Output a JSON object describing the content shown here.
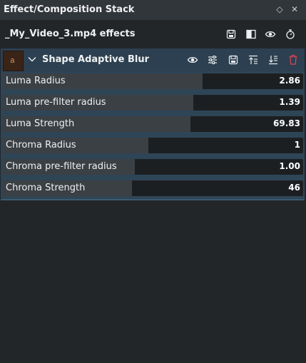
{
  "panel": {
    "title": "Effect/Composition Stack",
    "float_icon": "diamond-float-icon",
    "close_icon": "close-icon"
  },
  "clip": {
    "title": "_My_Video_3.mp4 effects",
    "actions": [
      {
        "name": "save-stack-button",
        "icon": "save-icon"
      },
      {
        "name": "split-compare-button",
        "icon": "split-view-icon"
      },
      {
        "name": "toggle-visibility-button",
        "icon": "eye-icon"
      },
      {
        "name": "timer-button",
        "icon": "stopwatch-icon"
      }
    ]
  },
  "effect": {
    "name": "Shape Adaptive Blur",
    "thumbnail_letter": "a",
    "actions": [
      {
        "name": "effect-visibility-button",
        "icon": "eye-icon"
      },
      {
        "name": "effect-settings-button",
        "icon": "sliders-icon"
      },
      {
        "name": "effect-save-button",
        "icon": "save-icon"
      },
      {
        "name": "effect-move-up-button",
        "icon": "move-up-icon"
      },
      {
        "name": "effect-move-down-button",
        "icon": "move-down-icon"
      },
      {
        "name": "effect-delete-button",
        "icon": "trash-icon"
      }
    ],
    "params": [
      {
        "label": "Luma Radius",
        "value": "2.86",
        "level": 0.665
      },
      {
        "label": "Luma pre-filter radius",
        "value": "1.39",
        "level": 0.635
      },
      {
        "label": "Luma Strength",
        "value": "69.83",
        "level": 0.625
      },
      {
        "label": "Chroma Radius",
        "value": "1",
        "level": 0.485
      },
      {
        "label": "Chroma pre-filter radius",
        "value": "1.00",
        "level": 0.44
      },
      {
        "label": "Chroma Strength",
        "value": "46",
        "level": 0.43
      }
    ]
  },
  "colors": {
    "background": "#232629",
    "titlebar": "#31363b",
    "effect_panel": "#2e4556",
    "slider_fill": "#3b4045",
    "slider_track": "#1c1f22",
    "delete_red": "#da4453"
  }
}
